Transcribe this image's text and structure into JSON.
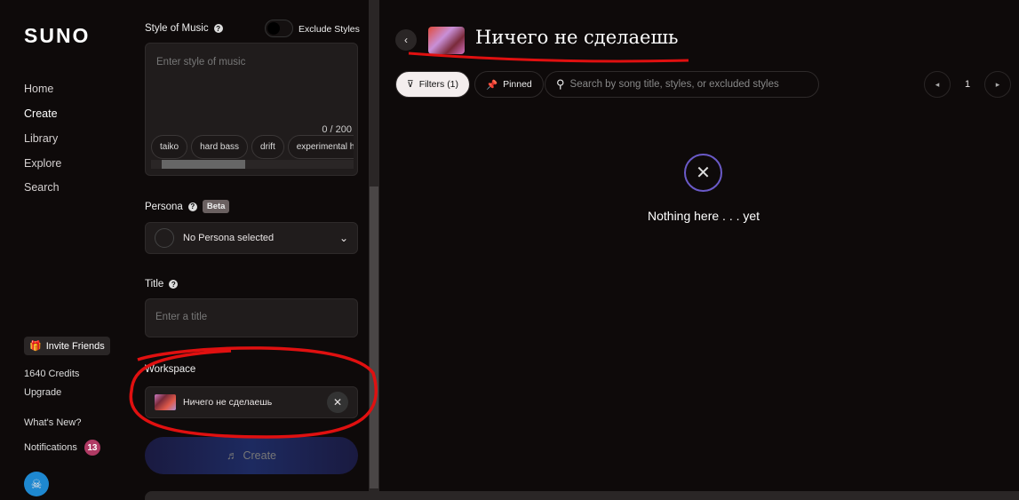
{
  "sidebar": {
    "logo": "SUNO",
    "nav": [
      "Home",
      "Create",
      "Library",
      "Explore",
      "Search"
    ],
    "invite": "Invite Friends",
    "credits": "1640 Credits",
    "upgrade": "Upgrade",
    "whats_new": "What's New?",
    "notifications": "Notifications",
    "notification_count": "13"
  },
  "form": {
    "style_label": "Style of Music",
    "exclude_label": "Exclude Styles",
    "style_placeholder": "Enter style of music",
    "style_count": "0 / 200",
    "chips": [
      "taiko",
      "hard bass",
      "drift",
      "experimental ho"
    ],
    "persona_label": "Persona",
    "beta": "Beta",
    "persona_value": "No Persona selected",
    "title_label": "Title",
    "title_placeholder": "Enter a title",
    "workspace_label": "Workspace",
    "workspace_value": "Ничего не сделаешь",
    "create": "Create"
  },
  "main": {
    "title": "Ничего не сделаешь",
    "filters": "Filters (1)",
    "pinned": "Pinned",
    "search_placeholder": "Search by song title, styles, or excluded styles",
    "page": "1",
    "empty": "Nothing here . . . yet"
  },
  "colors": {
    "annotation": "#e01010",
    "badge": "#b03a64"
  }
}
